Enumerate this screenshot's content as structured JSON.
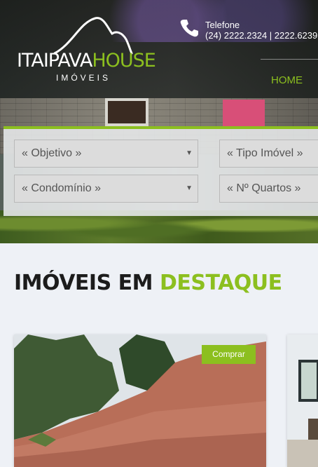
{
  "header": {
    "logo": {
      "word_1": "ITAIPAVA",
      "word_2": "HOUSE",
      "subtitle": "IMÓVEIS"
    },
    "contact": {
      "label": "Telefone",
      "numbers": "(24) 2222.2324 | 2222.6239"
    },
    "nav": {
      "home_label": "HOME"
    }
  },
  "search": {
    "objetivo": "« Objetivo »",
    "tipo_imovel": "« Tipo Imóvel »",
    "condominio": "« Condomínio »",
    "quartos": "« Nº Quartos »"
  },
  "featured": {
    "title_part_1": "IMÓVEIS EM ",
    "title_part_2": "DESTAQUE",
    "cards": [
      {
        "button_label": "Comprar"
      }
    ]
  },
  "colors": {
    "accent": "#8cbf1f",
    "text_dark": "#1c1c1c",
    "page_bg": "#eef1f6"
  },
  "icons": {
    "phone": "phone-icon",
    "logo_mark": "mountain-logo-icon",
    "select_arrow": "chevron-down-icon"
  }
}
